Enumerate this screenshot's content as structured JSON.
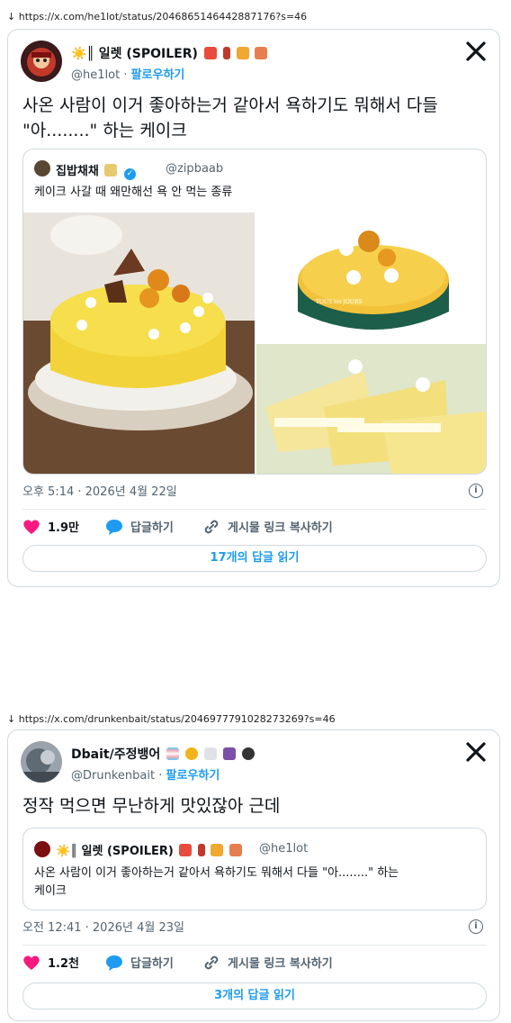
{
  "tweet1": {
    "url": "https://x.com/he1lot/status/2046865146442887176?s=46",
    "author_name": "☀️║ 일렛 (SPOILER)",
    "author_handle": "@he1lot",
    "follow_label": "팔로우하기",
    "text": "사온 사람이 이거 좋아하는거 같아서 욕하기도 뭐해서 다들 \"아........\" 하는 케이크",
    "quote": {
      "author_name": "집밥채채",
      "author_handle": "@zipbaab",
      "text": "케이크 사갈 때 왜만해선 욕 안 먹는 종류",
      "image_label": "TOUS les JOURS"
    },
    "timestamp": "오후 5:14 · 2026년 4월 22일",
    "likes": "1.9만",
    "reply_label": "답글하기",
    "copy_label": "게시물 링크 복사하기",
    "read_replies": "17개의 답글 읽기"
  },
  "tweet2": {
    "url": "https://x.com/drunkenbait/status/2046977791028273269?s=46",
    "author_name": "Dbait/주정뱅어",
    "author_handle": "@Drunkenbait",
    "follow_label": "팔로우하기",
    "text": "정작 먹으면 무난하게 맛있잖아 근데",
    "quote": {
      "author_name": "☀️║ 일렛 (SPOILER)",
      "author_handle": "@he1lot",
      "text_line1": "사온 사람이 이거 좋아하는거 같아서 욕하기도 뭐해서 다들 \"아........\" 하는",
      "text_line2": "케이크"
    },
    "timestamp": "오전 12:41 · 2026년 4월 23일",
    "likes": "1.2천",
    "reply_label": "답글하기",
    "copy_label": "게시물 링크 복사하기",
    "read_replies": "3개의 답글 읽기"
  },
  "icons": [
    "download-arrow-icon",
    "x-logo-icon",
    "heart-icon",
    "reply-bubble-icon",
    "link-icon",
    "info-icon",
    "verified-icon"
  ],
  "colors": {
    "accent": "#1d9bf0",
    "like": "#f91880",
    "border": "#cfd9de",
    "muted": "#536471"
  }
}
